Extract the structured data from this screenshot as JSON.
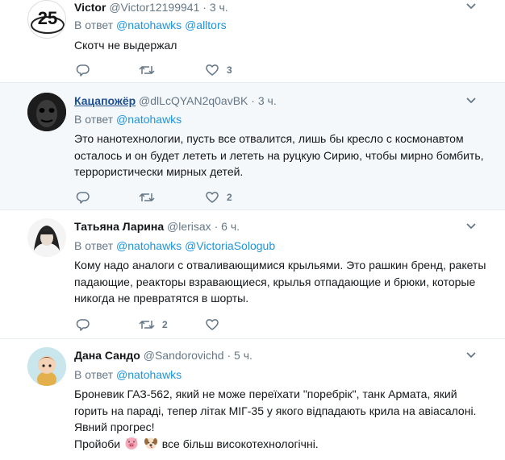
{
  "tweets": [
    {
      "name": "Victor",
      "handle": "@Victor12199941",
      "sep": "·",
      "time": "3 ч.",
      "reply_prefix": "В ответ",
      "mentions": [
        "@natohawks",
        "@alltors"
      ],
      "text": "Скотч не выдержал",
      "likes": "3",
      "retweets": "",
      "avatar_text": "25"
    },
    {
      "name": "Кацапожёр",
      "handle": "@dlLcQYAN2q0avBK",
      "sep": "·",
      "time": "3 ч.",
      "reply_prefix": "В ответ",
      "mentions": [
        "@natohawks"
      ],
      "text": "Это нанотехнологии, пусть все отвалится, лишь бы кресло с космонавтом осталось и он будет лететь и лететь на руцкую Сирию, чтобы мирно бомбить, террористически мирных детей.",
      "likes": "2",
      "retweets": ""
    },
    {
      "name": "Татьяна Ларина",
      "handle": "@lerisax",
      "sep": "·",
      "time": "6 ч.",
      "reply_prefix": "В ответ",
      "mentions": [
        "@natohawks",
        "@VictoriaSologub"
      ],
      "text": "Кому надо аналоги с отваливающимися крыльями. Это рашкин бренд, ракеты падающие, реакторы взравающиеся, крылья отпадающие и брюки, которые никогда не превратятся в шорты.",
      "likes": "",
      "retweets": "2"
    },
    {
      "name": "Дана Сандо",
      "handle": "@Sandorovichd",
      "sep": "·",
      "time": "5 ч.",
      "reply_prefix": "В ответ",
      "mentions": [
        "@natohawks"
      ],
      "text": "Броневик ГАЗ-562, який не може переїхати \"поребрік\", танк Армата, який горить на параді, тепер літак МІГ-35 у якого відпадають крила на авіасалоні. Явний прогрес!",
      "text2_a": "Пройоби",
      "text2_b": "все більш високотехнологічні.",
      "emojis": [
        "pig-face-icon",
        "dog-face-icon"
      ]
    }
  ],
  "colors": {
    "link": "#1b95e0",
    "meta": "#657786",
    "highlight_bg": "#f5f8fa",
    "divider": "#e6ecf0"
  }
}
